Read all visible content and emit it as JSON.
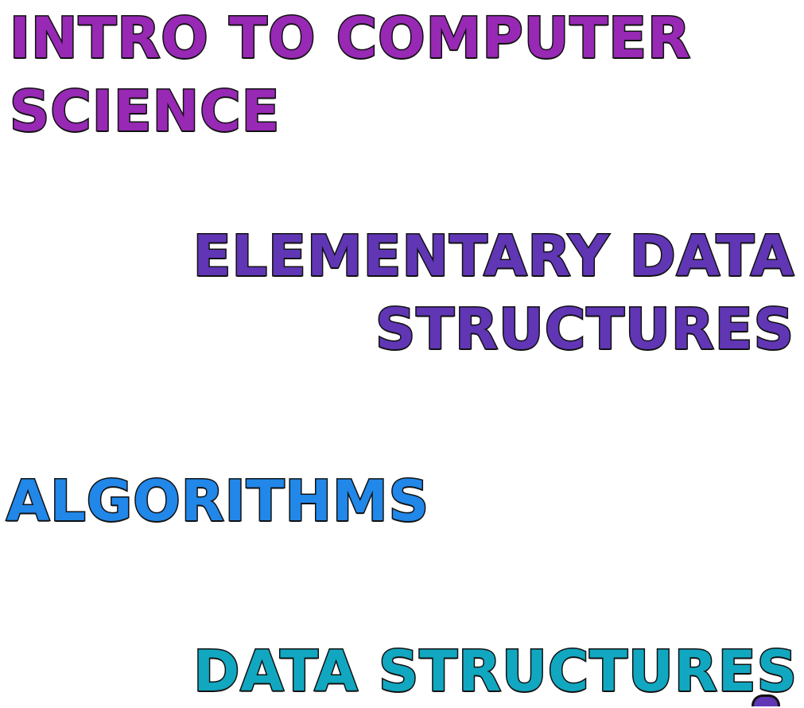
{
  "headings": [
    {
      "id": "intro",
      "lines": [
        "INTRO TO COMPUTER",
        "SCIENCE"
      ],
      "color": "#9729b4"
    },
    {
      "id": "elementary",
      "lines": [
        "ELEMENTARY DATA",
        "STRUCTURES"
      ],
      "color": "#6036b5"
    },
    {
      "id": "algorithms",
      "lines": [
        "ALGORITHMS"
      ],
      "color": "#2187e8"
    },
    {
      "id": "data_structures",
      "lines": [
        "DATA STRUCTURES"
      ],
      "color": "#12a7c0"
    }
  ]
}
